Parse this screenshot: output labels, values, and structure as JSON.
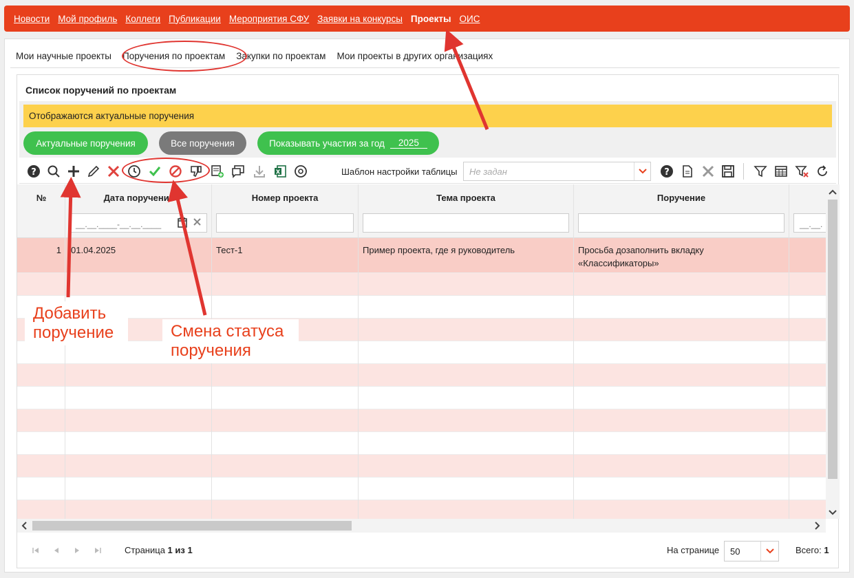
{
  "topnav": {
    "items": [
      "Новости",
      "Мой профиль",
      "Коллеги",
      "Публикации",
      "Мероприятия СФУ",
      "Заявки на конкурсы",
      "Проекты",
      "ОИС"
    ],
    "active_index": 6
  },
  "subtabs": [
    "Мои научные проекты",
    "Поручения по проектам",
    "Закупки по проектам",
    "Мои проекты в других организациях"
  ],
  "panel": {
    "title": "Список поручений по проектам",
    "notice": "Отображаются актуальные поручения",
    "btn_actual": "Актуальные поручения",
    "btn_all": "Все поручения",
    "btn_year_label": "Показывать участия за год",
    "year_value": "2025"
  },
  "toolbar": {
    "template_label": "Шаблон настройки таблицы",
    "template_placeholder": "Не задан",
    "icons": [
      "help-icon",
      "search-icon",
      "add-icon",
      "edit-icon",
      "delete-icon",
      "history-icon",
      "approve-icon",
      "cancel-status-icon",
      "dislike-icon",
      "add-doc-icon",
      "comments-icon",
      "download-icon",
      "excel-icon",
      "support-icon"
    ],
    "right_icons": [
      "help-icon",
      "document-icon",
      "close-icon",
      "save-icon",
      "filter-icon",
      "table-icon",
      "clear-filter-icon",
      "refresh-icon"
    ]
  },
  "table": {
    "columns": [
      "№",
      "Дата поручения",
      "Номер проекта",
      "Тема проекта",
      "Поручение"
    ],
    "date_filter_mask": "__.__.____-__.__.____",
    "next_filter_mask": "__.__.",
    "rows": [
      {
        "num": "1",
        "date": "01.04.2025",
        "project": "Тест-1",
        "topic": "Пример проекта, где я руководитель",
        "task": "Просьба дозаполнить вкладку «Классификаторы»"
      }
    ]
  },
  "pager": {
    "page_label": "Страница",
    "page_current": "1",
    "page_of": "из",
    "page_total": "1",
    "per_page_label": "На странице",
    "per_page_value": "50",
    "total_label": "Всего:",
    "total_value": "1"
  },
  "annotations": {
    "add": "Добавить поручение",
    "status": "Смена статуса поручения"
  },
  "colors": {
    "accent": "#e8401c",
    "notice": "#fdd14c",
    "green": "#3fc14e",
    "row_first": "#f9cdc6"
  }
}
